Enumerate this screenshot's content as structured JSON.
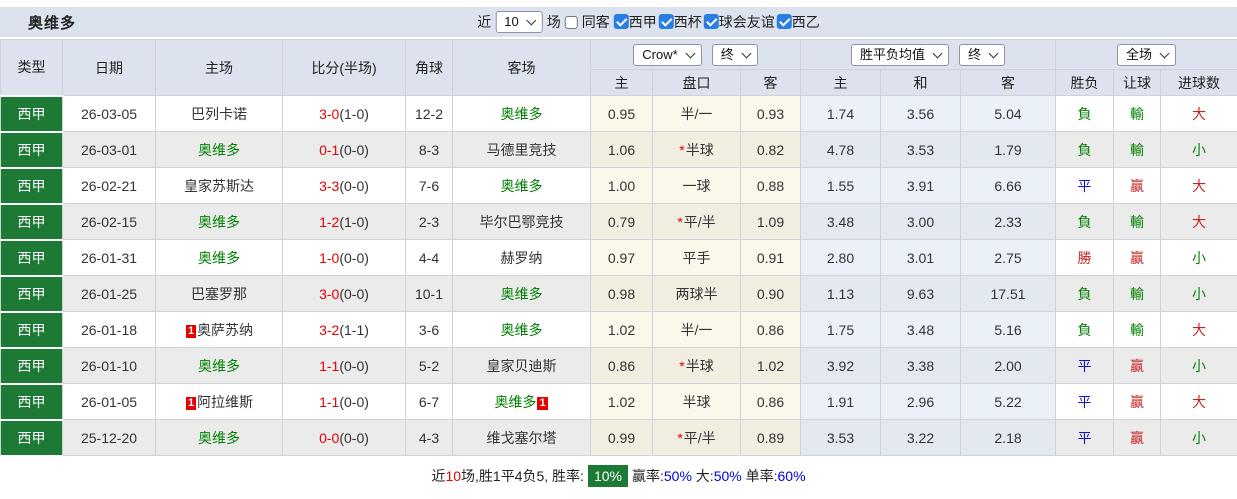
{
  "title": "奥维多",
  "toolbar": {
    "near_label": "近",
    "near_select_value": "10",
    "games_label": "场",
    "same_away_label": "同客",
    "leagues": [
      {
        "label": "西甲",
        "checked": true
      },
      {
        "label": "西杯",
        "checked": true
      },
      {
        "label": "球会友谊",
        "checked": true
      },
      {
        "label": "西乙",
        "checked": true
      }
    ]
  },
  "header": {
    "static_columns": [
      "类型",
      "日期",
      "主场",
      "比分(半场)",
      "角球",
      "客场"
    ],
    "asian_group": {
      "select1": "Crow*",
      "select2": "终",
      "sub_columns": [
        "主",
        "盘口",
        "客"
      ]
    },
    "avg_group": {
      "select1": "胜平负均值",
      "select2": "终",
      "sub_columns": [
        "主",
        "和",
        "客"
      ]
    },
    "result_group": {
      "select1": "全场",
      "sub_columns": [
        "胜负",
        "让球",
        "进球数"
      ]
    }
  },
  "rows": [
    {
      "league": "西甲",
      "date": "26-03-05",
      "home": {
        "name": "巴列卡诺",
        "is_focus": false
      },
      "score": {
        "full": "3-0",
        "half": "(1-0)"
      },
      "corners": "12-2",
      "away": {
        "name": "奥维多",
        "is_focus": true
      },
      "asian": {
        "home": "0.95",
        "star": false,
        "line": "半/一",
        "away": "0.93"
      },
      "avg": {
        "home": "1.74",
        "draw": "3.56",
        "away": "5.04"
      },
      "outcome": {
        "result": "負",
        "result_color": "green",
        "handicap": "輸",
        "handicap_color": "green",
        "goals": "大",
        "goals_color": "red"
      }
    },
    {
      "league": "西甲",
      "date": "26-03-01",
      "home": {
        "name": "奥维多",
        "is_focus": true
      },
      "score": {
        "full": "0-1",
        "half": "(0-0)"
      },
      "corners": "8-3",
      "away": {
        "name": "马德里竞技",
        "is_focus": false
      },
      "asian": {
        "home": "1.06",
        "star": true,
        "line": "半球",
        "away": "0.82"
      },
      "avg": {
        "home": "4.78",
        "draw": "3.53",
        "away": "1.79"
      },
      "outcome": {
        "result": "負",
        "result_color": "green",
        "handicap": "輸",
        "handicap_color": "green",
        "goals": "小",
        "goals_color": "green"
      }
    },
    {
      "league": "西甲",
      "date": "26-02-21",
      "home": {
        "name": "皇家苏斯达",
        "is_focus": false
      },
      "score": {
        "full": "3-3",
        "half": "(0-0)"
      },
      "corners": "7-6",
      "away": {
        "name": "奥维多",
        "is_focus": true
      },
      "asian": {
        "home": "1.00",
        "star": false,
        "line": "一球",
        "away": "0.88"
      },
      "avg": {
        "home": "1.55",
        "draw": "3.91",
        "away": "6.66"
      },
      "outcome": {
        "result": "平",
        "result_color": "blue",
        "handicap": "赢",
        "handicap_color": "red",
        "goals": "大",
        "goals_color": "red"
      }
    },
    {
      "league": "西甲",
      "date": "26-02-15",
      "home": {
        "name": "奥维多",
        "is_focus": true
      },
      "score": {
        "full": "1-2",
        "half": "(1-0)"
      },
      "corners": "2-3",
      "away": {
        "name": "毕尔巴鄂竞技",
        "is_focus": false
      },
      "asian": {
        "home": "0.79",
        "star": true,
        "line": "平/半",
        "away": "1.09"
      },
      "avg": {
        "home": "3.48",
        "draw": "3.00",
        "away": "2.33"
      },
      "outcome": {
        "result": "負",
        "result_color": "green",
        "handicap": "輸",
        "handicap_color": "green",
        "goals": "大",
        "goals_color": "red"
      }
    },
    {
      "league": "西甲",
      "date": "26-01-31",
      "home": {
        "name": "奥维多",
        "is_focus": true
      },
      "score": {
        "full": "1-0",
        "half": "(0-0)"
      },
      "corners": "4-4",
      "away": {
        "name": "赫罗纳",
        "is_focus": false
      },
      "asian": {
        "home": "0.97",
        "star": false,
        "line": "平手",
        "away": "0.91"
      },
      "avg": {
        "home": "2.80",
        "draw": "3.01",
        "away": "2.75"
      },
      "outcome": {
        "result": "勝",
        "result_color": "red",
        "handicap": "赢",
        "handicap_color": "red",
        "goals": "小",
        "goals_color": "green"
      }
    },
    {
      "league": "西甲",
      "date": "26-01-25",
      "home": {
        "name": "巴塞罗那",
        "is_focus": false
      },
      "score": {
        "full": "3-0",
        "half": "(0-0)"
      },
      "corners": "10-1",
      "away": {
        "name": "奥维多",
        "is_focus": true
      },
      "asian": {
        "home": "0.98",
        "star": false,
        "line": "两球半",
        "away": "0.90"
      },
      "avg": {
        "home": "1.13",
        "draw": "9.63",
        "away": "17.51"
      },
      "outcome": {
        "result": "負",
        "result_color": "green",
        "handicap": "輸",
        "handicap_color": "green",
        "goals": "小",
        "goals_color": "green"
      }
    },
    {
      "league": "西甲",
      "date": "26-01-18",
      "home": {
        "name": "奥萨苏纳",
        "is_focus": false,
        "red_card": "1",
        "red_card_pos": "before"
      },
      "score": {
        "full": "3-2",
        "half": "(1-1)"
      },
      "corners": "3-6",
      "away": {
        "name": "奥维多",
        "is_focus": true
      },
      "asian": {
        "home": "1.02",
        "star": false,
        "line": "半/一",
        "away": "0.86"
      },
      "avg": {
        "home": "1.75",
        "draw": "3.48",
        "away": "5.16"
      },
      "outcome": {
        "result": "負",
        "result_color": "green",
        "handicap": "輸",
        "handicap_color": "green",
        "goals": "大",
        "goals_color": "red"
      }
    },
    {
      "league": "西甲",
      "date": "26-01-10",
      "home": {
        "name": "奥维多",
        "is_focus": true
      },
      "score": {
        "full": "1-1",
        "half": "(0-0)"
      },
      "corners": "5-2",
      "away": {
        "name": "皇家贝迪斯",
        "is_focus": false
      },
      "asian": {
        "home": "0.86",
        "star": true,
        "line": "半球",
        "away": "1.02"
      },
      "avg": {
        "home": "3.92",
        "draw": "3.38",
        "away": "2.00"
      },
      "outcome": {
        "result": "平",
        "result_color": "blue",
        "handicap": "赢",
        "handicap_color": "red",
        "goals": "小",
        "goals_color": "green"
      }
    },
    {
      "league": "西甲",
      "date": "26-01-05",
      "home": {
        "name": "阿拉维斯",
        "is_focus": false,
        "red_card": "1",
        "red_card_pos": "before"
      },
      "score": {
        "full": "1-1",
        "half": "(0-0)"
      },
      "corners": "6-7",
      "away": {
        "name": "奥维多",
        "is_focus": true,
        "red_card": "1",
        "red_card_pos": "after"
      },
      "asian": {
        "home": "1.02",
        "star": false,
        "line": "半球",
        "away": "0.86"
      },
      "avg": {
        "home": "1.91",
        "draw": "2.96",
        "away": "5.22"
      },
      "outcome": {
        "result": "平",
        "result_color": "blue",
        "handicap": "赢",
        "handicap_color": "red",
        "goals": "大",
        "goals_color": "red"
      }
    },
    {
      "league": "西甲",
      "date": "25-12-20",
      "home": {
        "name": "奥维多",
        "is_focus": true
      },
      "score": {
        "full": "0-0",
        "half": "(0-0)"
      },
      "corners": "4-3",
      "away": {
        "name": "维戈塞尔塔",
        "is_focus": false
      },
      "asian": {
        "home": "0.99",
        "star": true,
        "line": "平/半",
        "away": "0.89"
      },
      "avg": {
        "home": "3.53",
        "draw": "3.22",
        "away": "2.18"
      },
      "outcome": {
        "result": "平",
        "result_color": "blue",
        "handicap": "赢",
        "handicap_color": "red",
        "goals": "小",
        "goals_color": "green"
      }
    }
  ],
  "summary": {
    "parts": [
      {
        "text": "近",
        "style": "plain"
      },
      {
        "text": "10",
        "style": "red"
      },
      {
        "text": "场,胜1平4负5, 胜率:",
        "style": "plain"
      },
      {
        "text": "10%",
        "style": "badge"
      },
      {
        "text": "赢率:",
        "style": "plain"
      },
      {
        "text": "50%",
        "style": "blue"
      },
      {
        "text": " 大:",
        "style": "plain"
      },
      {
        "text": "50%",
        "style": "blue"
      },
      {
        "text": " 单率:",
        "style": "plain"
      },
      {
        "text": "60%",
        "style": "blue"
      }
    ]
  },
  "colors": {
    "league_cell_green": "#1d7a35",
    "header_bg": "#dce3ef",
    "focus_team_green": "#008000",
    "score_red": "#e60000",
    "win_red": "#c52222",
    "draw_blue": "#1515c8",
    "loss_green": "#008000",
    "percent_blue": "#0000e0",
    "asian_tint": "#fbf7eb",
    "avg_tint": "#eaf1f9"
  }
}
